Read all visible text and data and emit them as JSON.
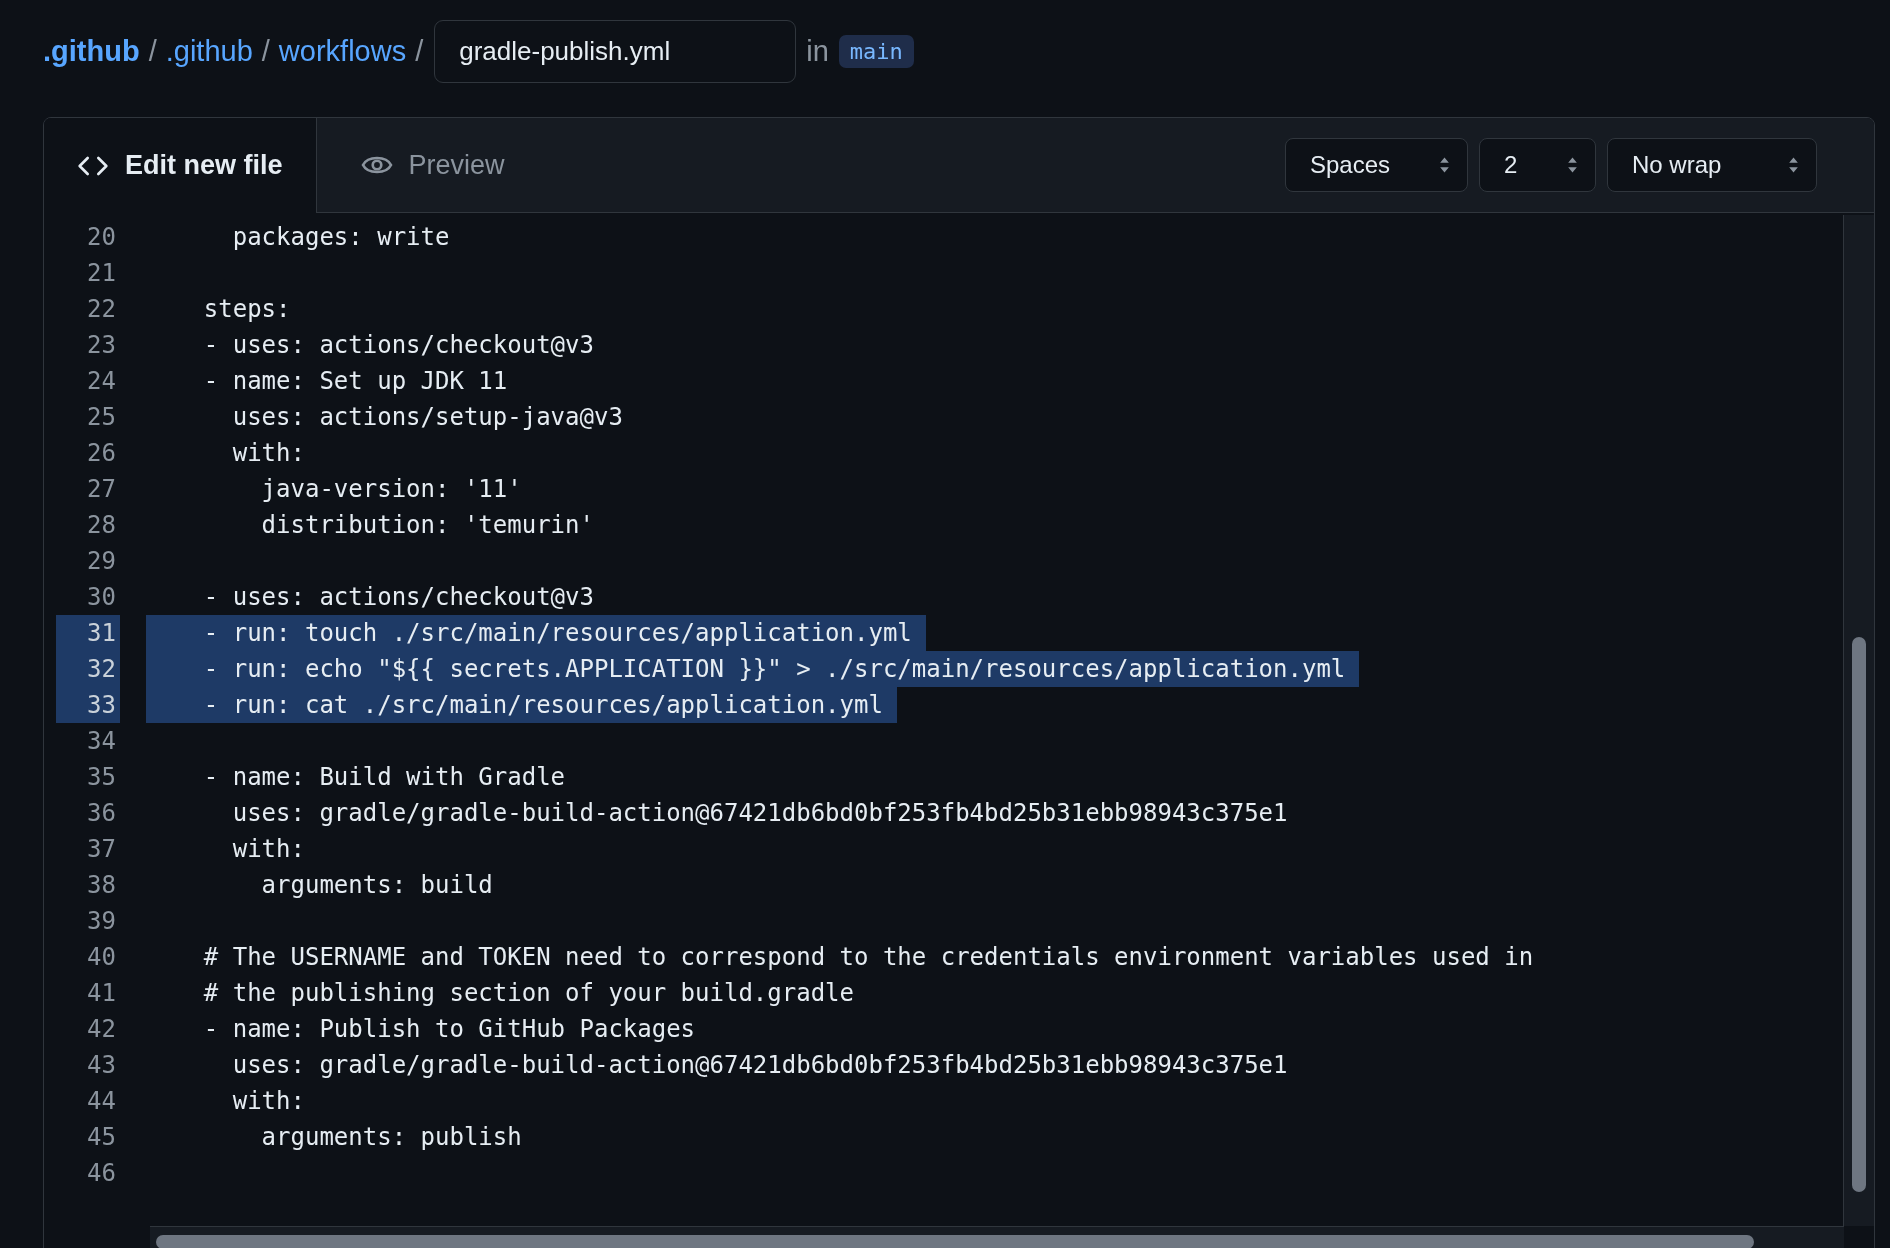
{
  "breadcrumb": {
    "items": [
      ".github",
      ".github",
      "workflows"
    ],
    "separators": [
      "/",
      "/",
      "/"
    ],
    "filename": "gradle-publish.yml",
    "in_label": "in",
    "branch": "main"
  },
  "tabs": [
    {
      "label": "Edit new file",
      "selected": true,
      "kind": "code"
    },
    {
      "label": "Preview",
      "selected": false,
      "kind": "eye"
    }
  ],
  "selects": [
    "Spaces",
    "2",
    "No wrap"
  ],
  "lines": [
    {
      "num": "20",
      "text": "      packages: write",
      "selected": false
    },
    {
      "num": "21",
      "selected": false
    },
    {
      "num": "22",
      "text": "    steps:",
      "selected": false
    },
    {
      "num": "23",
      "text": "    - uses: actions/checkout@v3",
      "selected": false
    },
    {
      "num": "24",
      "text": "    - name: Set up JDK 11",
      "selected": false
    },
    {
      "num": "25",
      "text": "      uses: actions/setup-java@v3",
      "selected": false
    },
    {
      "num": "26",
      "text": "      with:",
      "selected": false
    },
    {
      "num": "27",
      "text": "        java-version: '11'",
      "selected": false
    },
    {
      "num": "28",
      "text": "        distribution: 'temurin'",
      "selected": false
    },
    {
      "num": "29",
      "selected": false
    },
    {
      "num": "30",
      "text": "    - uses: actions/checkout@v3",
      "selected": false
    },
    {
      "num": "31",
      "text": "    - run: touch ./src/main/resources/application.yml",
      "selected": true
    },
    {
      "num": "32",
      "text": "    - run: echo \"${{ secrets.APPLICATION }}\" > ./src/main/resources/application.yml",
      "selected": true
    },
    {
      "num": "33",
      "text": "    - run: cat ./src/main/resources/application.yml",
      "selected": true
    },
    {
      "num": "34",
      "selected": false
    },
    {
      "num": "35",
      "text": "    - name: Build with Gradle",
      "selected": false
    },
    {
      "num": "36",
      "text": "      uses: gradle/gradle-build-action@67421db6bd0bf253fb4bd25b31ebb98943c375e1",
      "selected": false
    },
    {
      "num": "37",
      "text": "      with:",
      "selected": false
    },
    {
      "num": "38",
      "text": "        arguments: build",
      "selected": false
    },
    {
      "num": "39",
      "selected": false
    },
    {
      "num": "40",
      "text": "    # The USERNAME and TOKEN need to correspond to the credentials environment variables used in",
      "selected": false
    },
    {
      "num": "41",
      "text": "    # the publishing section of your build.gradle",
      "selected": false
    },
    {
      "num": "42",
      "text": "    - name: Publish to GitHub Packages",
      "selected": false
    },
    {
      "num": "43",
      "text": "      uses: gradle/gradle-build-action@67421db6bd0bf253fb4bd25b31ebb98943c375e1",
      "selected": false
    },
    {
      "num": "44",
      "text": "      with:",
      "selected": false
    },
    {
      "num": "45",
      "text": "        arguments: publish",
      "selected": false
    },
    {
      "num": "46",
      "selected": false
    }
  ]
}
